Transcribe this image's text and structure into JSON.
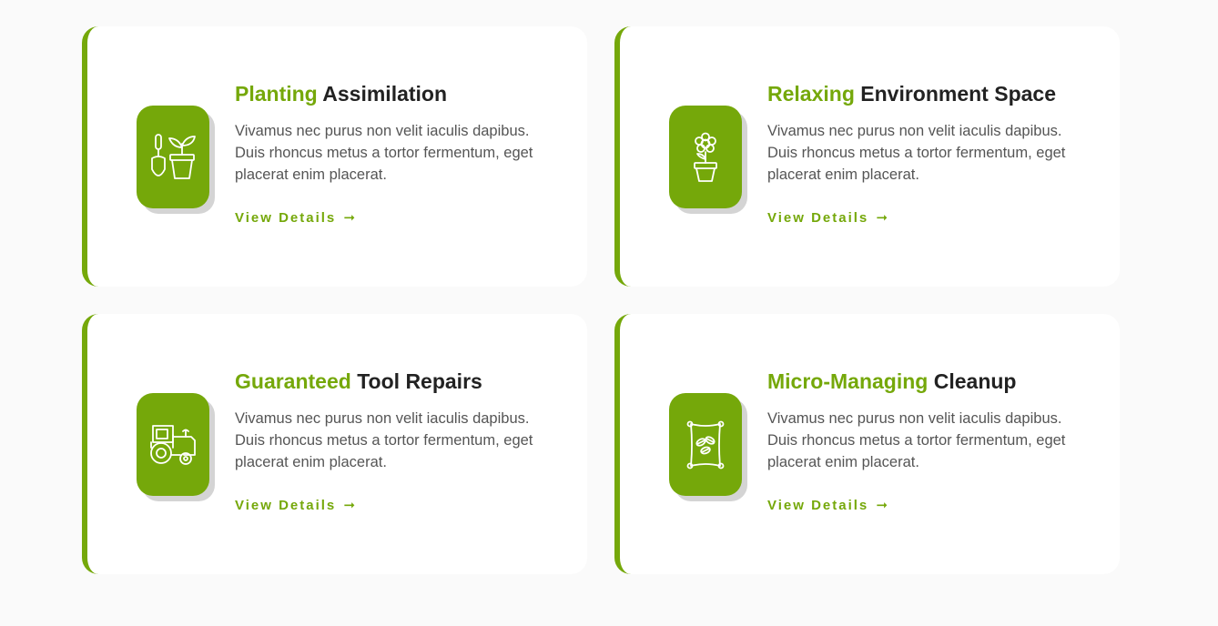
{
  "colors": {
    "accent": "#75a80a",
    "title": "#222222",
    "text": "#555555",
    "background": "#fafafa",
    "card": "#ffffff"
  },
  "cards": [
    {
      "icon": "garden-tools-plant-icon",
      "title_accent": "Planting",
      "title_rest": " Assimilation",
      "description": "Vivamus nec purus non velit iaculis dapibus. Duis rhoncus metus a tortor fermentum, eget placerat enim placerat.",
      "link_label": "View Details",
      "link_arrow": "➞"
    },
    {
      "icon": "flower-pot-icon",
      "title_accent": "Relaxing",
      "title_rest": " Environment Space",
      "description": "Vivamus nec purus non velit iaculis dapibus. Duis rhoncus metus a tortor fermentum, eget placerat enim placerat.",
      "link_label": "View Details",
      "link_arrow": "➞"
    },
    {
      "icon": "tractor-icon",
      "title_accent": "Guaranteed",
      "title_rest": " Tool Repairs",
      "description": "Vivamus nec purus non velit iaculis dapibus. Duis rhoncus metus a tortor fermentum, eget placerat enim placerat.",
      "link_label": "View Details",
      "link_arrow": "➞"
    },
    {
      "icon": "seed-bag-icon",
      "title_accent": "Micro-Managing",
      "title_rest": " Cleanup",
      "description": "Vivamus nec purus non velit iaculis dapibus. Duis rhoncus metus a tortor fermentum, eget placerat enim placerat.",
      "link_label": "View Details",
      "link_arrow": "➞"
    }
  ]
}
